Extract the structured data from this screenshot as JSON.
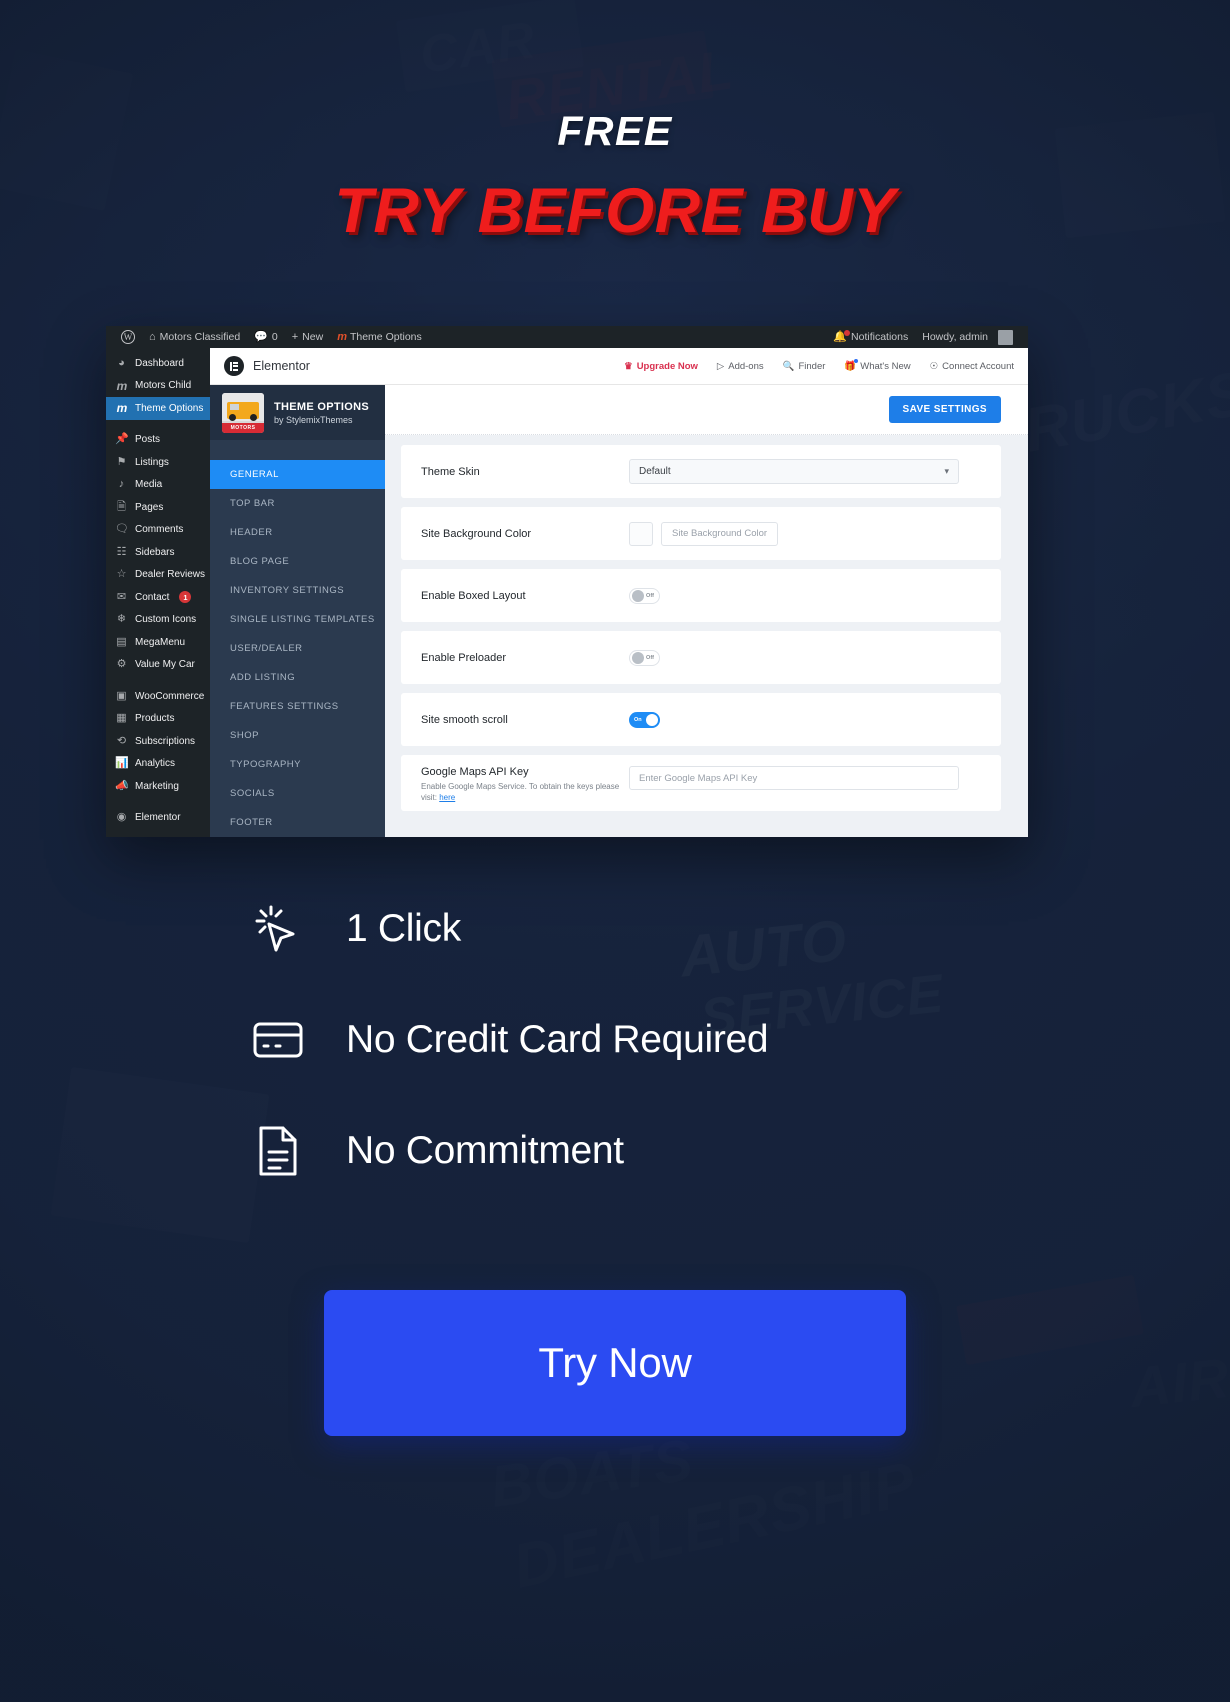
{
  "hero": {
    "eyebrow": "FREE",
    "headline": "TRY BEFORE BUY",
    "accent_color": "#ef1d1d"
  },
  "screenshot": {
    "adminbar": {
      "wp_logo": "wordpress-icon",
      "site_name": "Motors Classified",
      "comments_count": "0",
      "new_label": "New",
      "theme_options_label": "Theme Options",
      "notifications_label": "Notifications",
      "howdy_label": "Howdy, admin"
    },
    "sidebar": {
      "items": [
        {
          "label": "Dashboard",
          "icon": "dashboard-icon",
          "active": false
        },
        {
          "label": "Motors Child",
          "icon": "motors-logo-icon",
          "active": false
        },
        {
          "label": "Theme Options",
          "icon": "motors-logo-icon",
          "active": true
        },
        {
          "label": "Posts",
          "icon": "pin-icon",
          "active": false
        },
        {
          "label": "Listings",
          "icon": "listings-icon",
          "active": false
        },
        {
          "label": "Media",
          "icon": "media-icon",
          "active": false
        },
        {
          "label": "Pages",
          "icon": "pages-icon",
          "active": false
        },
        {
          "label": "Comments",
          "icon": "comment-icon",
          "active": false
        },
        {
          "label": "Sidebars",
          "icon": "sidebars-icon",
          "active": false
        },
        {
          "label": "Dealer Reviews",
          "icon": "dealer-reviews-icon",
          "active": false
        },
        {
          "label": "Contact",
          "icon": "envelope-icon",
          "active": false,
          "badge": "1"
        },
        {
          "label": "Custom Icons",
          "icon": "custom-icons-icon",
          "active": false
        },
        {
          "label": "MegaMenu",
          "icon": "megamenu-icon",
          "active": false
        },
        {
          "label": "Value My Car",
          "icon": "gear-icon",
          "active": false
        },
        {
          "label": "WooCommerce",
          "icon": "woocommerce-icon",
          "active": false
        },
        {
          "label": "Products",
          "icon": "products-icon",
          "active": false
        },
        {
          "label": "Subscriptions",
          "icon": "subscriptions-icon",
          "active": false
        },
        {
          "label": "Analytics",
          "icon": "analytics-icon",
          "active": false
        },
        {
          "label": "Marketing",
          "icon": "marketing-icon",
          "active": false
        },
        {
          "label": "Elementor",
          "icon": "elementor-icon",
          "active": false
        }
      ]
    },
    "elementor_bar": {
      "title": "Elementor",
      "nav": [
        {
          "label": "Upgrade Now",
          "icon": "crown-icon"
        },
        {
          "label": "Add-ons",
          "icon": "play-icon"
        },
        {
          "label": "Finder",
          "icon": "search-icon"
        },
        {
          "label": "What's New",
          "icon": "gift-icon"
        },
        {
          "label": "Connect Account",
          "icon": "account-icon"
        }
      ]
    },
    "theme_options": {
      "header_title": "THEME OPTIONS",
      "header_subtitle": "by StylemixThemes",
      "thumb_tag": "MOTORS",
      "tabs": [
        {
          "label": "GENERAL",
          "active": true
        },
        {
          "label": "TOP BAR",
          "active": false
        },
        {
          "label": "HEADER",
          "active": false
        },
        {
          "label": "BLOG PAGE",
          "active": false
        },
        {
          "label": "INVENTORY SETTINGS",
          "active": false
        },
        {
          "label": "SINGLE LISTING TEMPLATES",
          "active": false
        },
        {
          "label": "USER/DEALER",
          "active": false
        },
        {
          "label": "ADD LISTING",
          "active": false
        },
        {
          "label": "FEATURES SETTINGS",
          "active": false
        },
        {
          "label": "SHOP",
          "active": false
        },
        {
          "label": "TYPOGRAPHY",
          "active": false
        },
        {
          "label": "SOCIALS",
          "active": false
        },
        {
          "label": "FOOTER",
          "active": false
        }
      ],
      "save_label": "SAVE SETTINGS",
      "settings": {
        "theme_skin": {
          "label": "Theme Skin",
          "value": "Default"
        },
        "site_background_color": {
          "label": "Site Background Color",
          "placeholder": "Site Background Color",
          "swatch": "#fbfcfd"
        },
        "enable_boxed_layout": {
          "label": "Enable Boxed Layout",
          "state": "Off"
        },
        "enable_preloader": {
          "label": "Enable Preloader",
          "state": "Off"
        },
        "site_smooth_scroll": {
          "label": "Site smooth scroll",
          "state": "On"
        },
        "google_maps_api_key": {
          "label": "Google Maps API Key",
          "description": "Enable Google Maps Service. To obtain the keys please visit:",
          "link_label": "here",
          "placeholder": "Enter Google Maps API Key"
        }
      }
    }
  },
  "features": [
    {
      "label": "1 Click",
      "icon": "cursor-click-icon"
    },
    {
      "label": "No Credit Card Required",
      "icon": "credit-card-icon"
    },
    {
      "label": "No Commitment",
      "icon": "document-icon"
    }
  ],
  "cta": {
    "label": "Try Now",
    "color": "#2b4bf2"
  },
  "background_watermarks": [
    "CAR",
    "RENTAL",
    "TRUCKS",
    "AUTO",
    "SERVICE",
    "BOATS",
    "DEALERSHIP",
    "AIR"
  ]
}
